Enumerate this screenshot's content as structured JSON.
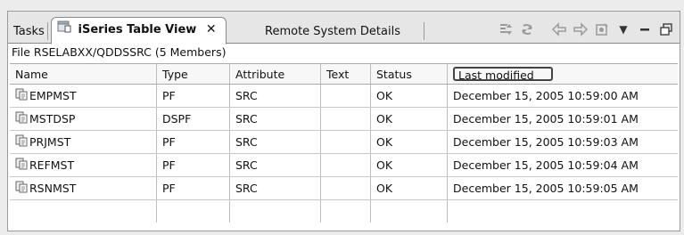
{
  "tabs": {
    "tasks_label": "Tasks",
    "active_label": "iSeries Table View",
    "close_glyph": "✕",
    "remote_label": "Remote System Details"
  },
  "toolbar": {
    "icons": [
      "filter-icon",
      "refresh-icon",
      "back-icon",
      "forward-icon",
      "home-icon",
      "view-menu-icon",
      "minimize-icon",
      "maximize-icon"
    ],
    "view_menu_glyph": "▼",
    "minimize_glyph": "▬",
    "maximize_glyph": "🗗"
  },
  "path_label": "File RSELABXX/QDDSSRC (5 Members)",
  "table": {
    "columns": {
      "name": "Name",
      "type": "Type",
      "attribute": "Attribute",
      "text": "Text",
      "status": "Status",
      "last_modified": "Last modified"
    },
    "rows": [
      {
        "name": "EMPMST",
        "type": "PF",
        "attribute": "SRC",
        "text": "",
        "status": "OK",
        "last_modified": "December 15, 2005 10:59:00 AM"
      },
      {
        "name": "MSTDSP",
        "type": "DSPF",
        "attribute": "SRC",
        "text": "",
        "status": "OK",
        "last_modified": "December 15, 2005 10:59:01 AM"
      },
      {
        "name": "PRJMST",
        "type": "PF",
        "attribute": "SRC",
        "text": "",
        "status": "OK",
        "last_modified": "December 15, 2005 10:59:03 AM"
      },
      {
        "name": "REFMST",
        "type": "PF",
        "attribute": "SRC",
        "text": "",
        "status": "OK",
        "last_modified": "December 15, 2005 10:59:04 AM"
      },
      {
        "name": "RSNMST",
        "type": "PF",
        "attribute": "SRC",
        "text": "",
        "status": "OK",
        "last_modified": "December 15, 2005 10:59:05 AM"
      }
    ]
  },
  "colors": {
    "toolbar_icon": "#9a9a9a",
    "highlight_border": "#444444"
  }
}
